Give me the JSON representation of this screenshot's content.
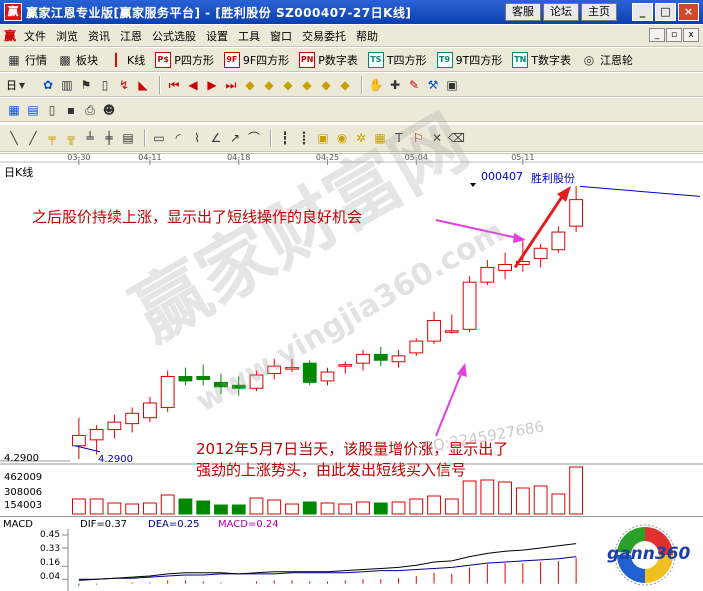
{
  "window": {
    "title": "赢家江恩专业版[赢家服务平台] - [胜利股份    SZ000407-27日K线]",
    "links": [
      "客服",
      "论坛",
      "主页"
    ],
    "controls": [
      "_",
      "□",
      "×"
    ]
  },
  "menu": {
    "logo": "赢",
    "items": [
      "文件",
      "浏览",
      "资讯",
      "江恩",
      "公式选股",
      "设置",
      "工具",
      "窗口",
      "交易委托",
      "帮助"
    ],
    "mdi": [
      "_",
      "▫",
      "x"
    ]
  },
  "toolbar1": [
    {
      "label": "行情",
      "icon": "grid-icon"
    },
    {
      "label": "板块",
      "icon": "blocks-icon"
    },
    {
      "label": "K线",
      "icon": "candles-icon"
    },
    {
      "label": "P四方形",
      "icon": "P$",
      "color": "red"
    },
    {
      "label": "9F四方形",
      "icon": "9F",
      "color": "red"
    },
    {
      "label": "P数字表",
      "icon": "PN",
      "color": "red"
    },
    {
      "label": "T四方形",
      "icon": "TS",
      "color": "teal"
    },
    {
      "label": "9T四方形",
      "icon": "T9",
      "color": "teal"
    },
    {
      "label": "T数字表",
      "icon": "TN",
      "color": "teal"
    },
    {
      "label": "江恩轮",
      "icon": "wheel-icon"
    }
  ],
  "toolbar2": {
    "period": "日"
  },
  "stock": {
    "period_label": "日K线",
    "code": "000407",
    "name": "胜利股份",
    "price_label": "4.2900",
    "price_label2": "4.2900",
    "volume_labels": [
      "462009",
      "308006",
      "154003"
    ]
  },
  "annotations": {
    "top": "之后股价持续上涨，显示出了短线操作的良好机会",
    "bottom_line1": "2012年5月7日当天，该股量增价涨，显示出了",
    "bottom_line2": "强劲的上涨势头，由此发出短线买入信号"
  },
  "watermark": {
    "main": "赢家财富网",
    "url": "www.yingjia360.com",
    "qq": "QQ:2245927686"
  },
  "macd": {
    "label": "MACD",
    "dif": "DIF=0.37",
    "dea": "DEA=0.25",
    "macd": "MACD=0.24",
    "ticks": [
      "0.45",
      "0.33",
      "0.16",
      "0.04"
    ]
  },
  "logo": {
    "text": "gann360"
  },
  "colors": {
    "up": "#e00000",
    "down": "#008800",
    "volume_up": "#e00000",
    "arrow": "#e040e0",
    "annotation": "#c00000"
  },
  "chart_data": {
    "type": "candlestick",
    "x_ticks": [
      "03-30",
      "04-11",
      "04-18",
      "04-25",
      "05-04",
      "05-11"
    ],
    "candles": [
      {
        "o": 4.29,
        "h": 4.48,
        "l": 4.2,
        "c": 4.36,
        "vol": 150000
      },
      {
        "o": 4.33,
        "h": 4.43,
        "l": 4.23,
        "c": 4.4,
        "vol": 150000
      },
      {
        "o": 4.4,
        "h": 4.5,
        "l": 4.34,
        "c": 4.45,
        "vol": 110000
      },
      {
        "o": 4.44,
        "h": 4.55,
        "l": 4.38,
        "c": 4.51,
        "vol": 100000
      },
      {
        "o": 4.48,
        "h": 4.62,
        "l": 4.45,
        "c": 4.58,
        "vol": 110000
      },
      {
        "o": 4.55,
        "h": 4.8,
        "l": 4.52,
        "c": 4.76,
        "vol": 190000
      },
      {
        "o": 4.76,
        "h": 4.82,
        "l": 4.7,
        "c": 4.73,
        "vol": 150000
      },
      {
        "o": 4.76,
        "h": 4.84,
        "l": 4.7,
        "c": 4.74,
        "vol": 130000
      },
      {
        "o": 4.72,
        "h": 4.78,
        "l": 4.64,
        "c": 4.69,
        "vol": 90000
      },
      {
        "o": 4.7,
        "h": 4.76,
        "l": 4.63,
        "c": 4.68,
        "vol": 90000
      },
      {
        "o": 4.68,
        "h": 4.8,
        "l": 4.66,
        "c": 4.77,
        "vol": 160000
      },
      {
        "o": 4.78,
        "h": 4.88,
        "l": 4.74,
        "c": 4.83,
        "vol": 140000
      },
      {
        "o": 4.82,
        "h": 4.88,
        "l": 4.79,
        "c": 4.82,
        "vol": 100000
      },
      {
        "o": 4.85,
        "h": 4.87,
        "l": 4.7,
        "c": 4.72,
        "vol": 120000
      },
      {
        "o": 4.73,
        "h": 4.82,
        "l": 4.7,
        "c": 4.79,
        "vol": 110000
      },
      {
        "o": 4.84,
        "h": 4.86,
        "l": 4.78,
        "c": 4.84,
        "vol": 100000
      },
      {
        "o": 4.85,
        "h": 4.94,
        "l": 4.8,
        "c": 4.91,
        "vol": 120000
      },
      {
        "o": 4.91,
        "h": 4.96,
        "l": 4.83,
        "c": 4.87,
        "vol": 110000
      },
      {
        "o": 4.86,
        "h": 4.94,
        "l": 4.82,
        "c": 4.9,
        "vol": 120000
      },
      {
        "o": 4.92,
        "h": 5.02,
        "l": 4.9,
        "c": 5.0,
        "vol": 150000
      },
      {
        "o": 5.0,
        "h": 5.2,
        "l": 4.98,
        "c": 5.14,
        "vol": 180000
      },
      {
        "o": 5.07,
        "h": 5.18,
        "l": 5.05,
        "c": 5.07,
        "vol": 150000
      },
      {
        "o": 5.08,
        "h": 5.44,
        "l": 5.06,
        "c": 5.4,
        "vol": 330000
      },
      {
        "o": 5.4,
        "h": 5.55,
        "l": 5.38,
        "c": 5.5,
        "vol": 340000
      },
      {
        "o": 5.48,
        "h": 5.6,
        "l": 5.42,
        "c": 5.52,
        "vol": 320000
      },
      {
        "o": 5.52,
        "h": 5.68,
        "l": 5.47,
        "c": 5.54,
        "vol": 260000
      },
      {
        "o": 5.56,
        "h": 5.66,
        "l": 5.5,
        "c": 5.63,
        "vol": 280000
      },
      {
        "o": 5.62,
        "h": 5.78,
        "l": 5.6,
        "c": 5.74,
        "vol": 200000
      },
      {
        "o": 5.78,
        "h": 6.05,
        "l": 5.74,
        "c": 5.96,
        "vol": 470000
      }
    ],
    "macd_bars": [
      -0.02,
      -0.01,
      0.0,
      0.01,
      0.01,
      0.03,
      0.03,
      0.02,
      0.01,
      0.0,
      0.02,
      0.03,
      0.03,
      0.02,
      0.02,
      0.03,
      0.04,
      0.04,
      0.05,
      0.07,
      0.1,
      0.09,
      0.15,
      0.18,
      0.19,
      0.19,
      0.2,
      0.21,
      0.24
    ],
    "dif": [
      0.03,
      0.04,
      0.05,
      0.06,
      0.07,
      0.09,
      0.1,
      0.1,
      0.1,
      0.09,
      0.1,
      0.11,
      0.11,
      0.11,
      0.11,
      0.12,
      0.13,
      0.14,
      0.15,
      0.17,
      0.2,
      0.21,
      0.25,
      0.28,
      0.3,
      0.31,
      0.33,
      0.35,
      0.37
    ],
    "dea": [
      0.04,
      0.04,
      0.05,
      0.05,
      0.06,
      0.07,
      0.08,
      0.08,
      0.09,
      0.09,
      0.09,
      0.09,
      0.1,
      0.1,
      0.1,
      0.1,
      0.11,
      0.12,
      0.12,
      0.13,
      0.14,
      0.15,
      0.17,
      0.19,
      0.2,
      0.21,
      0.22,
      0.23,
      0.25
    ]
  }
}
